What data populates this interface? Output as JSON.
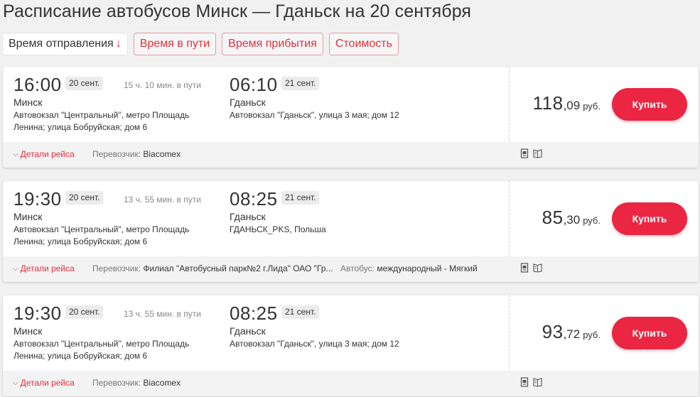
{
  "page_title": "Расписание автобусов Минск — Гданьск на 20 сентября",
  "sort": {
    "departure": "Время отправления",
    "departure_arrow": "↓",
    "duration": "Время в пути",
    "arrival": "Время прибытия",
    "price": "Стоимость"
  },
  "trips": [
    {
      "dep_time": "16:00",
      "dep_date": "20 сент.",
      "duration": "15 ч. 10 мин. в пути",
      "dep_city": "Минск",
      "dep_station_1": "Автовокзал \"Центральный\", метро Площадь",
      "dep_station_2": "Ленина; улица Бобруйская; дом 6",
      "arr_time": "06:10",
      "arr_date": "21 сент.",
      "arr_city": "Гданьск",
      "arr_station_1": "Автовокзал \"Гданьск\", улица 3 мая; дом 12",
      "arr_station_2": "",
      "price_int": "118",
      "price_frac": ",09",
      "currency": "руб.",
      "buy": "Купить",
      "details": "Детали рейса",
      "carrier_label": "Перевозчик:",
      "carrier": "Biacomex",
      "bus_label": "",
      "bus": ""
    },
    {
      "dep_time": "19:30",
      "dep_date": "20 сент.",
      "duration": "13 ч. 55 мин. в пути",
      "dep_city": "Минск",
      "dep_station_1": "Автовокзал \"Центральный\", метро Площадь",
      "dep_station_2": "Ленина; улица Бобруйская; дом 6",
      "arr_time": "08:25",
      "arr_date": "21 сент.",
      "arr_city": "Гданьск",
      "arr_station_1": "ГДАНЬСК_PKS, Польша",
      "arr_station_2": "",
      "price_int": "85",
      "price_frac": ",30",
      "currency": "руб.",
      "buy": "Купить",
      "details": "Детали рейса",
      "carrier_label": "Перевозчик:",
      "carrier": "Филиал \"Автобусный парк№2 г.Лида\" ОАО \"Гр...",
      "bus_label": "Автобус:",
      "bus": "международный - Мягкий"
    },
    {
      "dep_time": "19:30",
      "dep_date": "20 сент.",
      "duration": "13 ч. 55 мин. в пути",
      "dep_city": "Минск",
      "dep_station_1": "Автовокзал \"Центральный\", метро Площадь",
      "dep_station_2": "Ленина; улица Бобруйская; дом 6",
      "arr_time": "08:25",
      "arr_date": "21 сент.",
      "arr_city": "Гданьск",
      "arr_station_1": "Автовокзал \"Гданьск\", улица 3 мая; дом 12",
      "arr_station_2": "",
      "price_int": "93",
      "price_frac": ",72",
      "currency": "руб.",
      "buy": "Купить",
      "details": "Детали рейса",
      "carrier_label": "Перевозчик:",
      "carrier": "Biacomex",
      "bus_label": "",
      "bus": ""
    }
  ],
  "colors": {
    "accent": "#eb2642",
    "link": "#e0303e"
  },
  "icons": [
    "document-icon",
    "book-icon"
  ]
}
